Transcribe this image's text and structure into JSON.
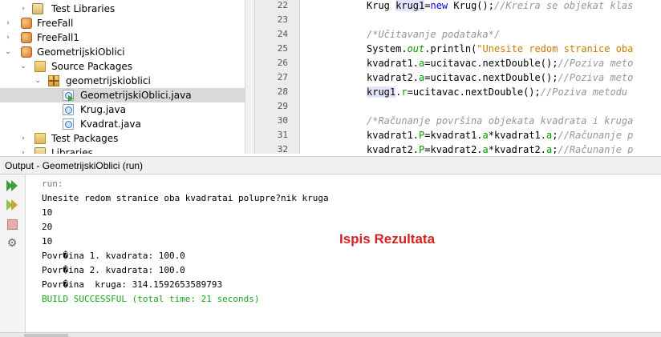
{
  "project_tree": {
    "items": [
      {
        "label": "Test Libraries",
        "icon": "library-icon"
      },
      {
        "label": "FreeFall",
        "icon": "project-icon"
      },
      {
        "label": "FreeFall1",
        "icon": "project-icon"
      },
      {
        "label": "GeometrijskiOblici",
        "icon": "project-icon"
      },
      {
        "label": "Source Packages",
        "icon": "folder-icon"
      },
      {
        "label": "geometrijskioblici",
        "icon": "package-icon"
      },
      {
        "label": "GeometrijskiOblici.java",
        "icon": "java-main-file-icon"
      },
      {
        "label": "Krug.java",
        "icon": "java-file-icon"
      },
      {
        "label": "Kvadrat.java",
        "icon": "java-file-icon"
      },
      {
        "label": "Test Packages",
        "icon": "folder-icon"
      },
      {
        "label": "Libraries",
        "icon": "library-icon"
      }
    ]
  },
  "editor": {
    "line_numbers": [
      "22",
      "23",
      "24",
      "25",
      "26",
      "27",
      "28",
      "29",
      "30",
      "31",
      "32"
    ],
    "line_22": {
      "t1": "Krug ",
      "t2": "krug1",
      "t3": "=",
      "t4": "new",
      "t5": " Krug();",
      "t6": "//Kreira se objekat klas"
    },
    "line_24": "/*Učitavanje podataka*/",
    "line_25": {
      "t1": "System.",
      "t2": "out",
      "t3": ".println(",
      "t4": "\"Unesite redom stranice oba"
    },
    "line_26": {
      "t1": "kvadrat1.",
      "t2": "a",
      "t3": "=ucitavac.nextDouble();",
      "t4": "//Poziva meto"
    },
    "line_27": {
      "t1": "kvadrat2.",
      "t2": "a",
      "t3": "=ucitavac.nextDouble();",
      "t4": "//Poziva meto"
    },
    "line_28": {
      "t1": "krug1",
      "t2": ".",
      "t3": "r",
      "t4": "=ucitavac.nextDouble();",
      "t5": "//Poziva metodu"
    },
    "line_30": "/*Računanje površina objekata kvadrata i kruga",
    "line_31": {
      "t1": "kvadrat1.",
      "t2": "P",
      "t3": "=kvadrat1.",
      "t4": "a",
      "t5": "*kvadrat1.",
      "t6": "a",
      "t7": ";",
      "t8": "//Računanje p"
    },
    "line_32": {
      "t1": "kvadrat2.",
      "t2": "P",
      "t3": "=kvadrat2.",
      "t4": "a",
      "t5": "*kvadrat2.",
      "t6": "a",
      "t7": ";",
      "t8": "//Računanje p"
    }
  },
  "output": {
    "title": "Output - GeometrijskiOblici (run)",
    "lines": [
      "run:",
      "Unesite redom stranice oba kvadratai polupre?nik kruga",
      "10",
      "20",
      "10",
      "Povr�ina 1. kvadrata: 100.0",
      "Povr�ina 2. kvadrata: 100.0",
      "Povr�ina  kruga: 314.1592653589793",
      "BUILD SUCCESSFUL (total time: 21 seconds)"
    ],
    "annotation": "Ispis Rezultata"
  },
  "colors": {
    "keyword": "#0000e6",
    "string": "#ce7b00",
    "comment": "#969696",
    "field": "#009900",
    "success": "#16a616",
    "annotation": "#d42222",
    "selection": "#d9d9d9"
  }
}
